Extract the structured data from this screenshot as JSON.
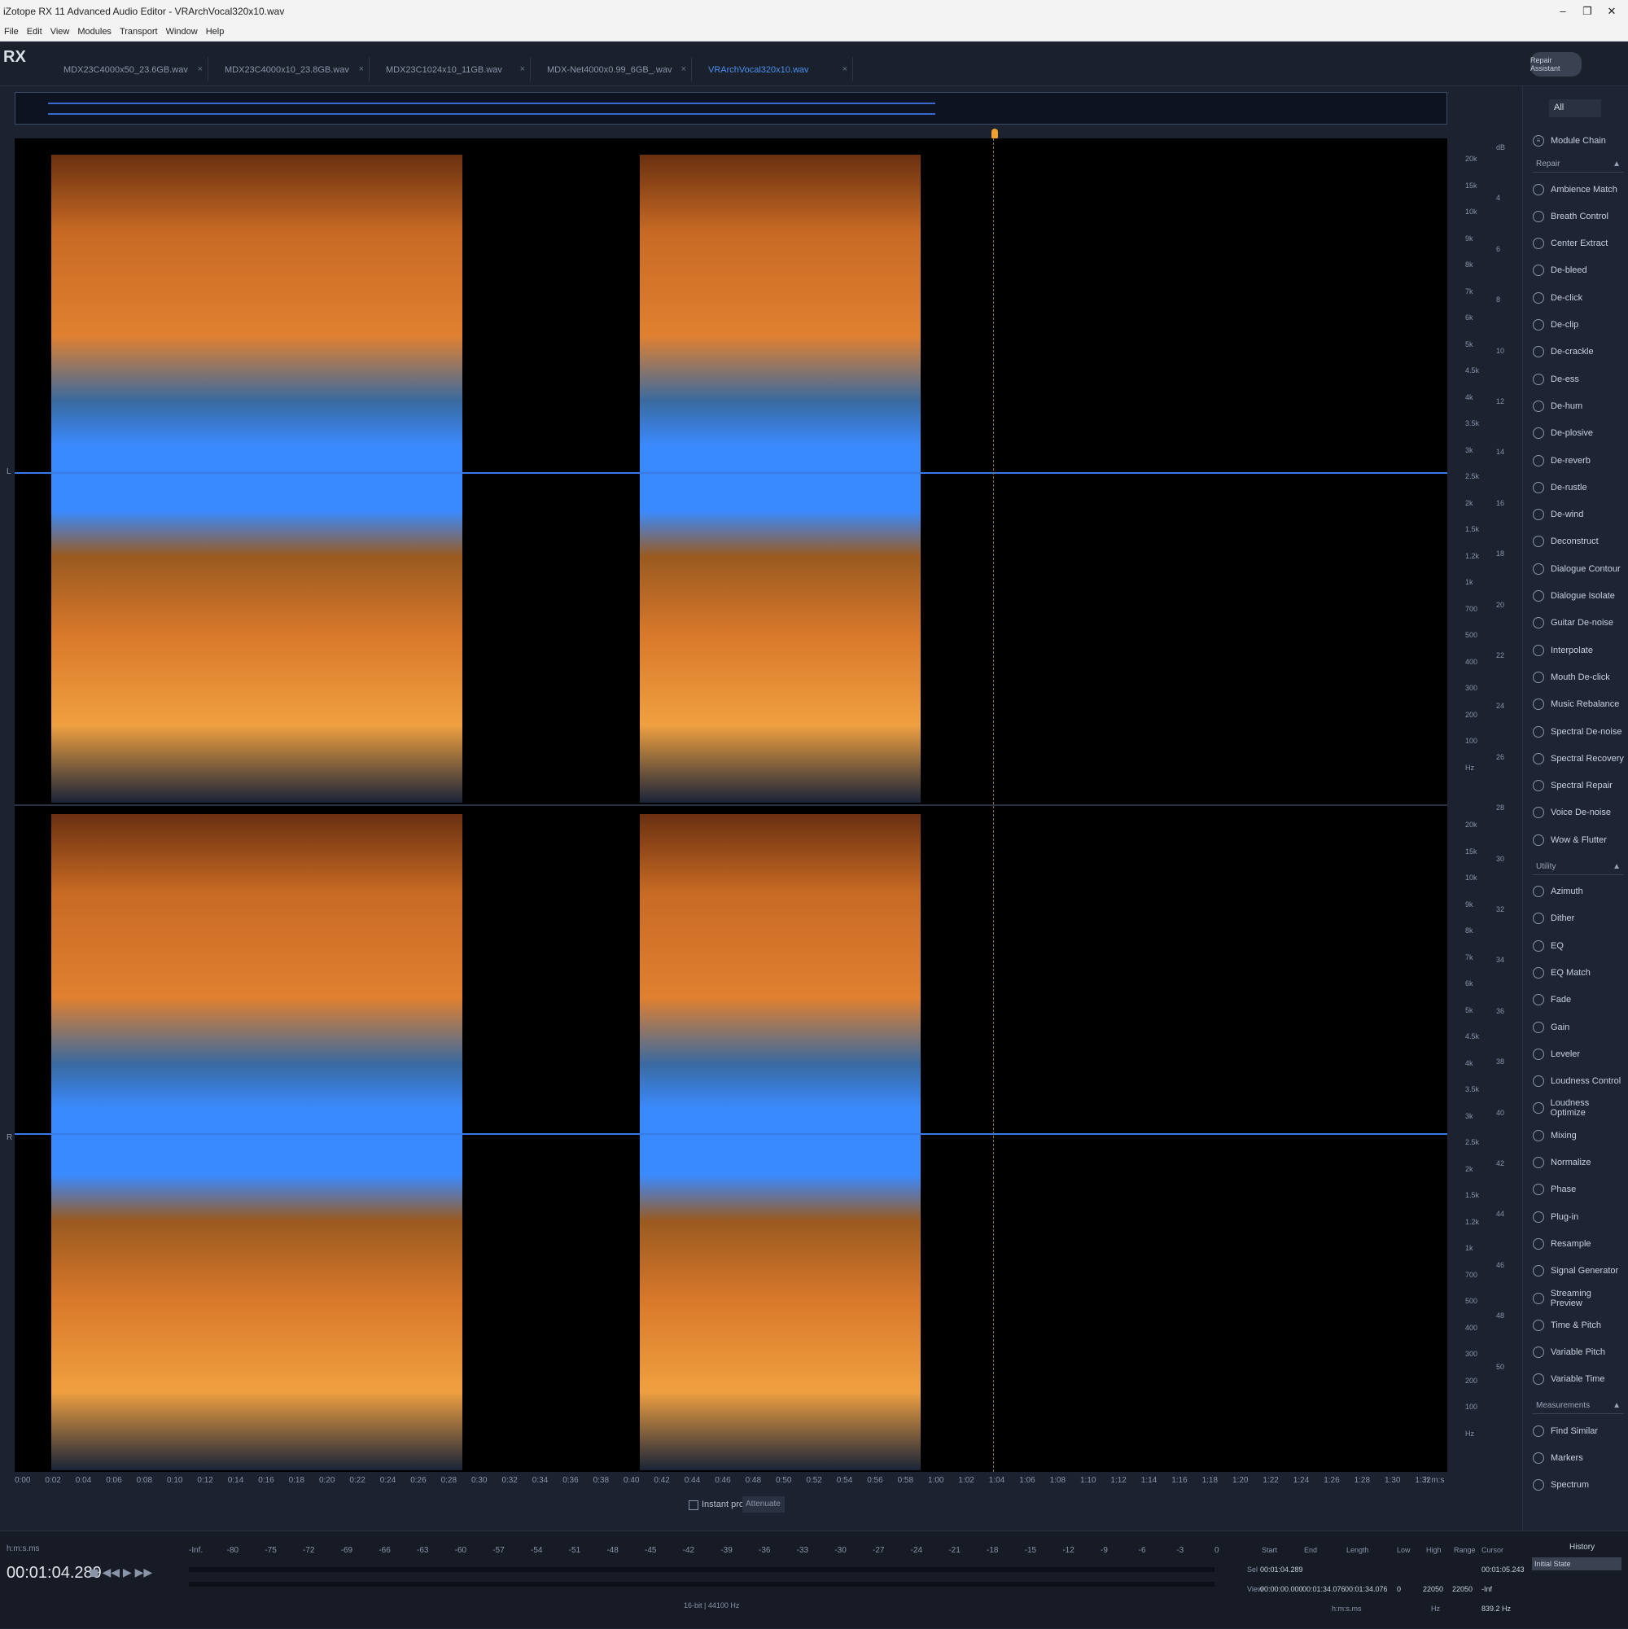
{
  "window": {
    "title": "iZotope RX 11 Advanced Audio Editor - VRArchVocal320x10.wav"
  },
  "menu": [
    "File",
    "Edit",
    "View",
    "Modules",
    "Transport",
    "Window",
    "Help"
  ],
  "tabs": [
    {
      "label": "MDX23C4000x50_23.6GB.wav"
    },
    {
      "label": "MDX23C4000x10_23.8GB.wav"
    },
    {
      "label": "MDX23C1024x10_11GB.wav"
    },
    {
      "label": "MDX-Net4000x0.99_6GB_.wav"
    },
    {
      "label": "VRArchVocal320x10.wav",
      "active": true
    }
  ],
  "logo": "RX",
  "repair_assistant": "Repair Assistant",
  "channels": [
    "L",
    "R"
  ],
  "freq_labels": [
    "20k",
    "15k",
    "10k",
    "9k",
    "8k",
    "7k",
    "6k",
    "5k",
    "4.5k",
    "4k",
    "3.5k",
    "3k",
    "2.5k",
    "2k",
    "1.5k",
    "1.2k",
    "1k",
    "700",
    "500",
    "400",
    "300",
    "200",
    "100",
    "Hz"
  ],
  "level_labels": [
    "dB",
    "4",
    "6",
    "8",
    "10",
    "12",
    "14",
    "16",
    "18",
    "20",
    "22",
    "24",
    "26",
    "28",
    "30",
    "32",
    "34",
    "36",
    "38",
    "40",
    "42",
    "44",
    "46",
    "48",
    "50"
  ],
  "time_labels": [
    "0:00",
    "0:02",
    "0:04",
    "0:06",
    "0:08",
    "0:10",
    "0:12",
    "0:14",
    "0:16",
    "0:18",
    "0:20",
    "0:22",
    "0:24",
    "0:26",
    "0:28",
    "0:30",
    "0:32",
    "0:34",
    "0:36",
    "0:38",
    "0:40",
    "0:42",
    "0:44",
    "0:46",
    "0:48",
    "0:50",
    "0:52",
    "0:54",
    "0:56",
    "0:58",
    "1:00",
    "1:02",
    "1:04",
    "1:06",
    "1:08",
    "1:10",
    "1:12",
    "1:14",
    "1:16",
    "1:18",
    "1:20",
    "1:22",
    "1:24",
    "1:26",
    "1:28",
    "1:30",
    "1:32",
    "h:m:s"
  ],
  "toolbar": {
    "instant_process": "Instant process",
    "mode": "Attenuate"
  },
  "sidebar": {
    "filter": "All",
    "module_chain": "Module Chain",
    "sections": [
      {
        "name": "Repair",
        "items": [
          "Ambience Match",
          "Breath Control",
          "Center Extract",
          "De-bleed",
          "De-click",
          "De-clip",
          "De-crackle",
          "De-ess",
          "De-hum",
          "De-plosive",
          "De-reverb",
          "De-rustle",
          "De-wind",
          "Deconstruct",
          "Dialogue Contour",
          "Dialogue Isolate",
          "Guitar De-noise",
          "Interpolate",
          "Mouth De-click",
          "Music Rebalance",
          "Spectral De-noise",
          "Spectral Recovery",
          "Spectral Repair",
          "Voice De-noise",
          "Wow & Flutter"
        ]
      },
      {
        "name": "Utility",
        "items": [
          "Azimuth",
          "Dither",
          "EQ",
          "EQ Match",
          "Fade",
          "Gain",
          "Leveler",
          "Loudness Control",
          "Loudness Optimize",
          "Mixing",
          "Normalize",
          "Phase",
          "Plug-in",
          "Resample",
          "Signal Generator",
          "Streaming Preview",
          "Time & Pitch",
          "Variable Pitch",
          "Variable Time"
        ]
      },
      {
        "name": "Measurements",
        "items": [
          "Find Similar",
          "Markers",
          "Spectrum"
        ]
      }
    ]
  },
  "transport": {
    "format": "h:m:s.ms",
    "time": "00:01:04.289"
  },
  "meter_labels": [
    "-Inf.",
    "-80",
    "-75",
    "-72",
    "-69",
    "-66",
    "-63",
    "-60",
    "-57",
    "-54",
    "-51",
    "-48",
    "-45",
    "-42",
    "-39",
    "-36",
    "-33",
    "-30",
    "-27",
    "-24",
    "-21",
    "-18",
    "-15",
    "-12",
    "-9",
    "-6",
    "-3",
    "0"
  ],
  "format_info": "16-bit | 44100 Hz",
  "selection": {
    "headers": [
      "Start",
      "End",
      "Length",
      "Low",
      "High",
      "Range",
      "Cursor"
    ],
    "sel_label": "Sel",
    "sel_start": "00:01:04.289",
    "view_label": "View",
    "view_start": "00:00:00.000",
    "view_end": "00:01:34.076",
    "view_length": "00:01:34.076",
    "low": "0",
    "high": "22050",
    "range": "22050",
    "cursor_time": "00:01:05.243",
    "cursor_db": "-Inf",
    "cursor_hz": "839.2 Hz",
    "unit_time": "h:m:s.ms",
    "unit_hz": "Hz"
  },
  "history": {
    "title": "History",
    "item": "Initial State"
  }
}
